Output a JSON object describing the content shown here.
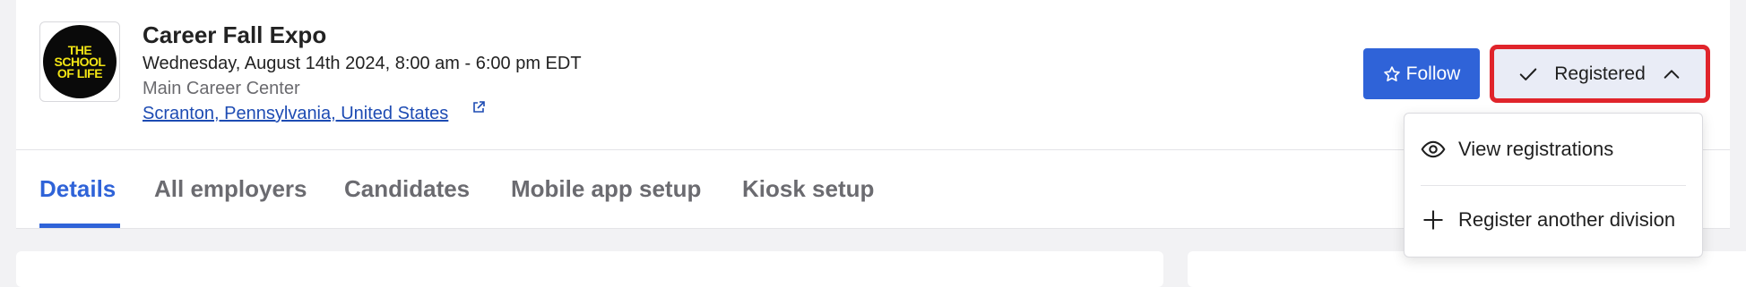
{
  "event": {
    "logo_text": [
      "THE",
      "SCHOOL",
      "OF LIFE"
    ],
    "title": "Career Fall Expo",
    "date": "Wednesday, August 14th 2024, 8:00 am - 6:00 pm EDT",
    "venue": "Main Career Center",
    "location": "Scranton, Pennsylvania, United States"
  },
  "actions": {
    "follow_label": "Follow",
    "registered_label": "Registered"
  },
  "tabs": [
    {
      "label": "Details",
      "active": true
    },
    {
      "label": "All employers",
      "active": false
    },
    {
      "label": "Candidates",
      "active": false
    },
    {
      "label": "Mobile app setup",
      "active": false
    },
    {
      "label": "Kiosk setup",
      "active": false
    }
  ],
  "dropdown": {
    "items": [
      {
        "label": "View registrations",
        "icon": "eye-icon"
      },
      {
        "label": "Register another division",
        "icon": "plus-icon"
      }
    ]
  },
  "colors": {
    "accent": "#2f63d8",
    "highlight": "#e0242b",
    "logo_yellow": "#f3e514"
  }
}
